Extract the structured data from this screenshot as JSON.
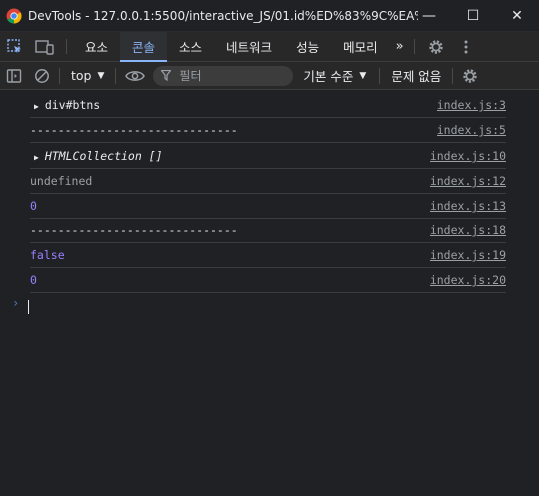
{
  "window": {
    "title": "DevTools - 127.0.0.1:5500/interactive_JS/01.id%ED%83%9C%EA%B7...",
    "minimize": "—",
    "maximize": "☐",
    "close": "✕"
  },
  "tabs": {
    "items": [
      "요소",
      "콘솔",
      "소스",
      "네트워크",
      "성능",
      "메모리"
    ],
    "active_index": 1,
    "more": "»"
  },
  "console_toolbar": {
    "context": "top",
    "filter_placeholder": "필터",
    "levels": "기본 수준",
    "issues": "문제 없음"
  },
  "console": {
    "rows": [
      {
        "message": "div#btns",
        "source": "index.js:3",
        "style": "plain",
        "expandable": true
      },
      {
        "message": "------------------------------",
        "source": "index.js:5",
        "style": "plain",
        "expandable": false
      },
      {
        "message": "HTMLCollection []",
        "source": "index.js:10",
        "style": "italic",
        "expandable": true
      },
      {
        "message": "undefined",
        "source": "index.js:12",
        "style": "grey",
        "expandable": false
      },
      {
        "message": "0",
        "source": "index.js:13",
        "style": "num",
        "expandable": false
      },
      {
        "message": "------------------------------",
        "source": "index.js:18",
        "style": "plain",
        "expandable": false
      },
      {
        "message": "false",
        "source": "index.js:19",
        "style": "num",
        "expandable": false
      },
      {
        "message": "0",
        "source": "index.js:20",
        "style": "num",
        "expandable": false
      }
    ],
    "prompt": "›"
  },
  "colors": {
    "accent": "#8ab4f8",
    "background": "#202124",
    "number": "#9980ff"
  }
}
